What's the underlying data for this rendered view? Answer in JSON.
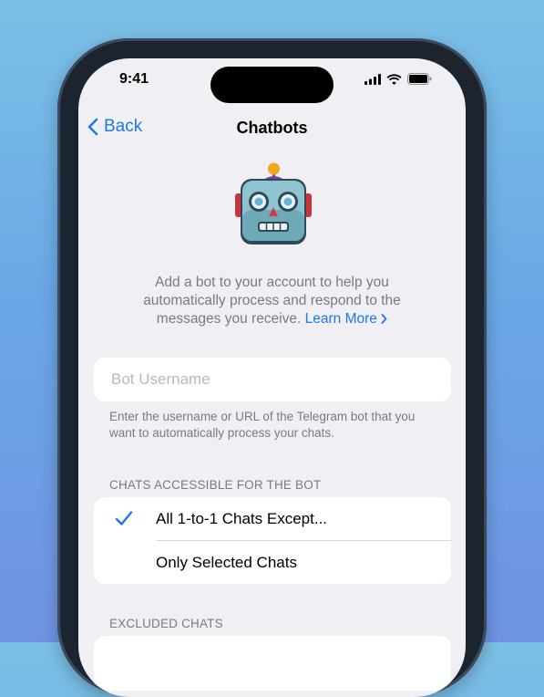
{
  "status": {
    "time": "9:41"
  },
  "nav": {
    "back_label": "Back",
    "title": "Chatbots"
  },
  "intro": {
    "text": "Add a bot to your account to help you automatically process and respond to the messages you receive.",
    "link": "Learn More"
  },
  "bot_input": {
    "placeholder": "Bot Username",
    "value": ""
  },
  "hint": "Enter the username or URL of the Telegram bot that you want to automatically process your chats.",
  "chats_section": {
    "header": "CHATS ACCESSIBLE FOR THE BOT",
    "options": [
      {
        "label": "All 1-to-1 Chats Except...",
        "selected": true
      },
      {
        "label": "Only Selected Chats",
        "selected": false
      }
    ]
  },
  "excluded_section": {
    "header": "EXCLUDED CHATS"
  },
  "colors": {
    "accent": "#1f7ae0",
    "background": "#efeff4",
    "secondary_text": "#7a7a80"
  }
}
